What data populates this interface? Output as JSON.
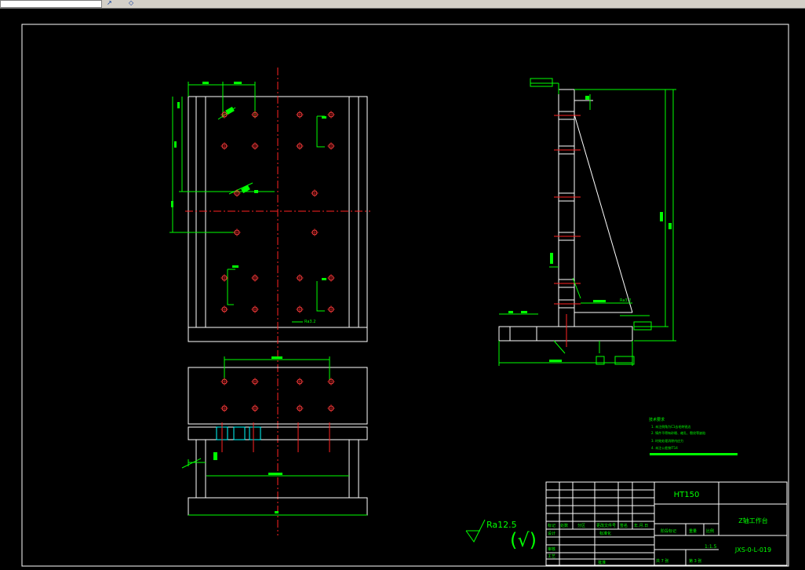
{
  "toolbar": {
    "icon_a": "↗",
    "icon_b": "◇"
  },
  "title_block": {
    "material": "HT150",
    "part_name": "Z轴工作台",
    "drawing_number": "JXS-0-L-019",
    "scale": "1:1.5",
    "sheet_total": "共 7 张",
    "sheet_index": "第 3 张",
    "labels": {
      "mark": "标记",
      "count": "处数",
      "zone": "分区",
      "change_doc": "更改文件号",
      "sign": "签名",
      "date": "年.月.日",
      "designer": "设计",
      "standardize": "标准化",
      "stage_mark": "阶段标记",
      "weight": "重量",
      "ratio": "比例",
      "review": "审核",
      "process": "工艺",
      "approve": "批准"
    }
  },
  "roughness": {
    "value": "Ra12.5",
    "bracket": "(√)"
  },
  "feature_labels": [
    "Ra3.2",
    "Ra3.2",
    "Ra3.2"
  ],
  "notes": {
    "heading": "技术要求",
    "lines": [
      "1. 未注倒角为C1去毛刺锐边",
      "2. 铸件不得有砂眼、缩孔、裂纹等缺陷",
      "3. 时效处理消除内应力",
      "4. 未注公差按IT14"
    ]
  },
  "colors": {
    "frame": "#ffffff",
    "dimension": "#00ff00",
    "center": "#ff2222",
    "hole": "#ff4444",
    "accent": "#00ffff"
  }
}
